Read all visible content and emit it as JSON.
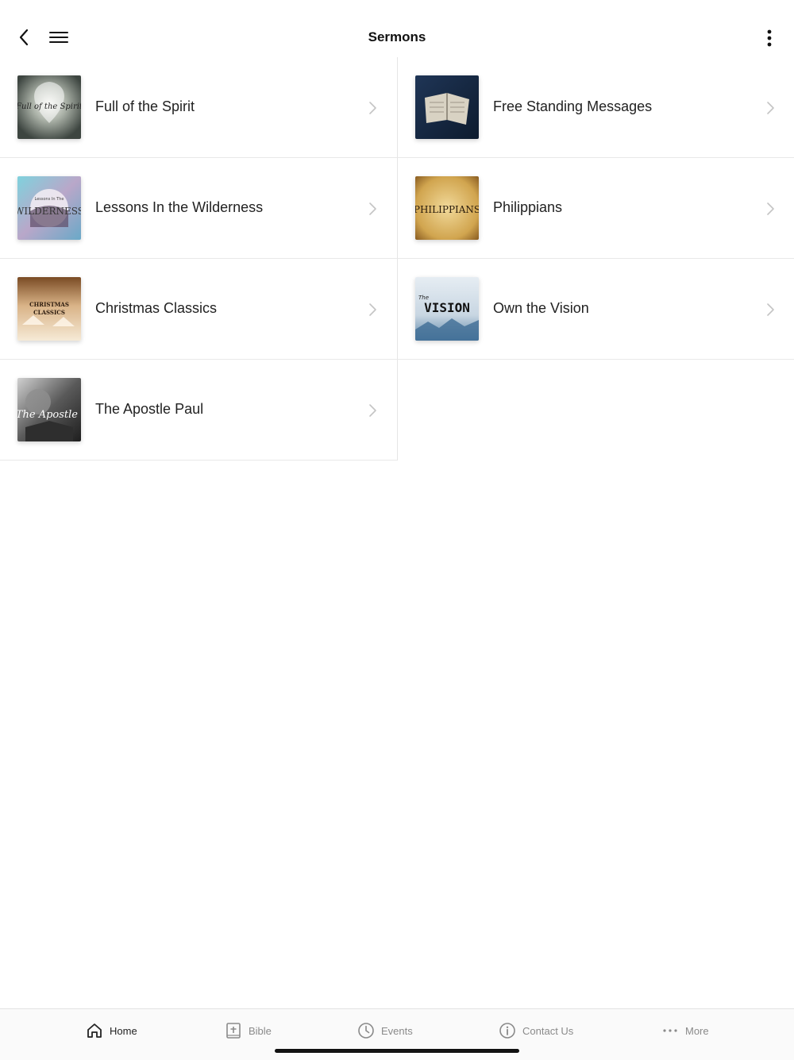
{
  "header": {
    "title": "Sermons"
  },
  "sermons": [
    {
      "label": "Full of the Spirit",
      "thumb_text": "Full of the Spirit"
    },
    {
      "label": "Free Standing Messages",
      "thumb_text": ""
    },
    {
      "label": "Lessons In the Wilderness",
      "thumb_text": "WILDERNESS",
      "thumb_subtext": "Lessons In The"
    },
    {
      "label": "Philippians",
      "thumb_text": "PHILIPPIANS"
    },
    {
      "label": "Christmas Classics",
      "thumb_text": "CHRISTMAS CLASSICS"
    },
    {
      "label": "Own the Vision",
      "thumb_text": "VISION",
      "thumb_subtext": "The"
    },
    {
      "label": "The Apostle Paul",
      "thumb_text": "The Apostle"
    }
  ],
  "tabs": [
    {
      "label": "Home",
      "icon": "home-icon",
      "active": true
    },
    {
      "label": "Bible",
      "icon": "bible-icon",
      "active": false
    },
    {
      "label": "Events",
      "icon": "clock-icon",
      "active": false
    },
    {
      "label": "Contact Us",
      "icon": "info-icon",
      "active": false
    },
    {
      "label": "More",
      "icon": "more-dots-icon",
      "active": false
    }
  ],
  "colors": {
    "active_tab": "#222222",
    "inactive_tab": "#8a8a8a",
    "divider": "#e5e5e5"
  }
}
